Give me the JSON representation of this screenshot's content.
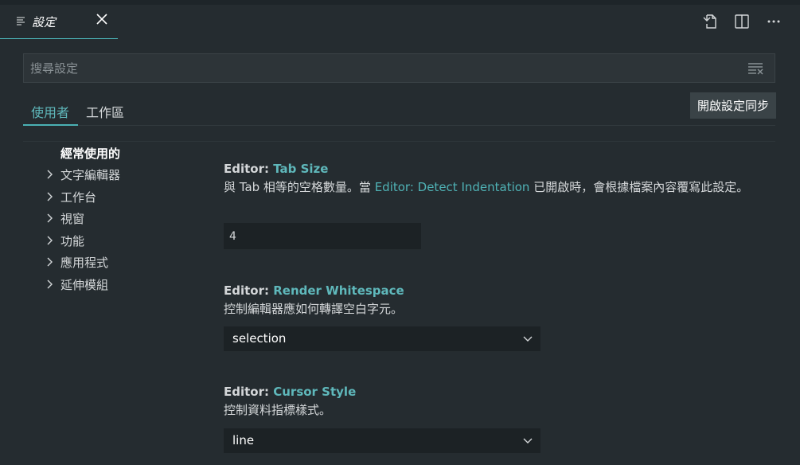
{
  "editor_tab": {
    "title": "設定"
  },
  "search": {
    "placeholder": "搜尋設定",
    "value": ""
  },
  "scope_tabs": {
    "user": "使用者",
    "workspace": "工作區",
    "active": "user"
  },
  "sync_button": "開啟設定同步",
  "toc": {
    "heading": "經常使用的",
    "items": [
      {
        "label": "文字編輯器"
      },
      {
        "label": "工作台"
      },
      {
        "label": "視窗"
      },
      {
        "label": "功能"
      },
      {
        "label": "應用程式"
      },
      {
        "label": "延伸模組"
      }
    ]
  },
  "settings": {
    "tab_size": {
      "category": "Editor: ",
      "name": "Tab Size",
      "desc_before": "與 Tab 相等的空格數量。當 ",
      "desc_link": "Editor: Detect Indentation",
      "desc_after": " 已開啟時，會根據檔案內容覆寫此設定。",
      "value": "4"
    },
    "render_whitespace": {
      "category": "Editor: ",
      "name": "Render Whitespace",
      "desc": "控制編輯器應如何轉譯空白字元。",
      "value": "selection"
    },
    "cursor_style": {
      "category": "Editor: ",
      "name": "Cursor Style",
      "desc": "控制資料指標樣式。",
      "value": "line"
    }
  },
  "colors": {
    "accent": "#4ab0b3",
    "background": "#252c30",
    "input_background": "#1c2225"
  },
  "icons": [
    "settings-file-icon",
    "close-icon",
    "open-json-icon",
    "split-editor-icon",
    "more-actions-icon",
    "clear-filter-icon",
    "chevron-right-icon",
    "chevron-down-icon"
  ]
}
